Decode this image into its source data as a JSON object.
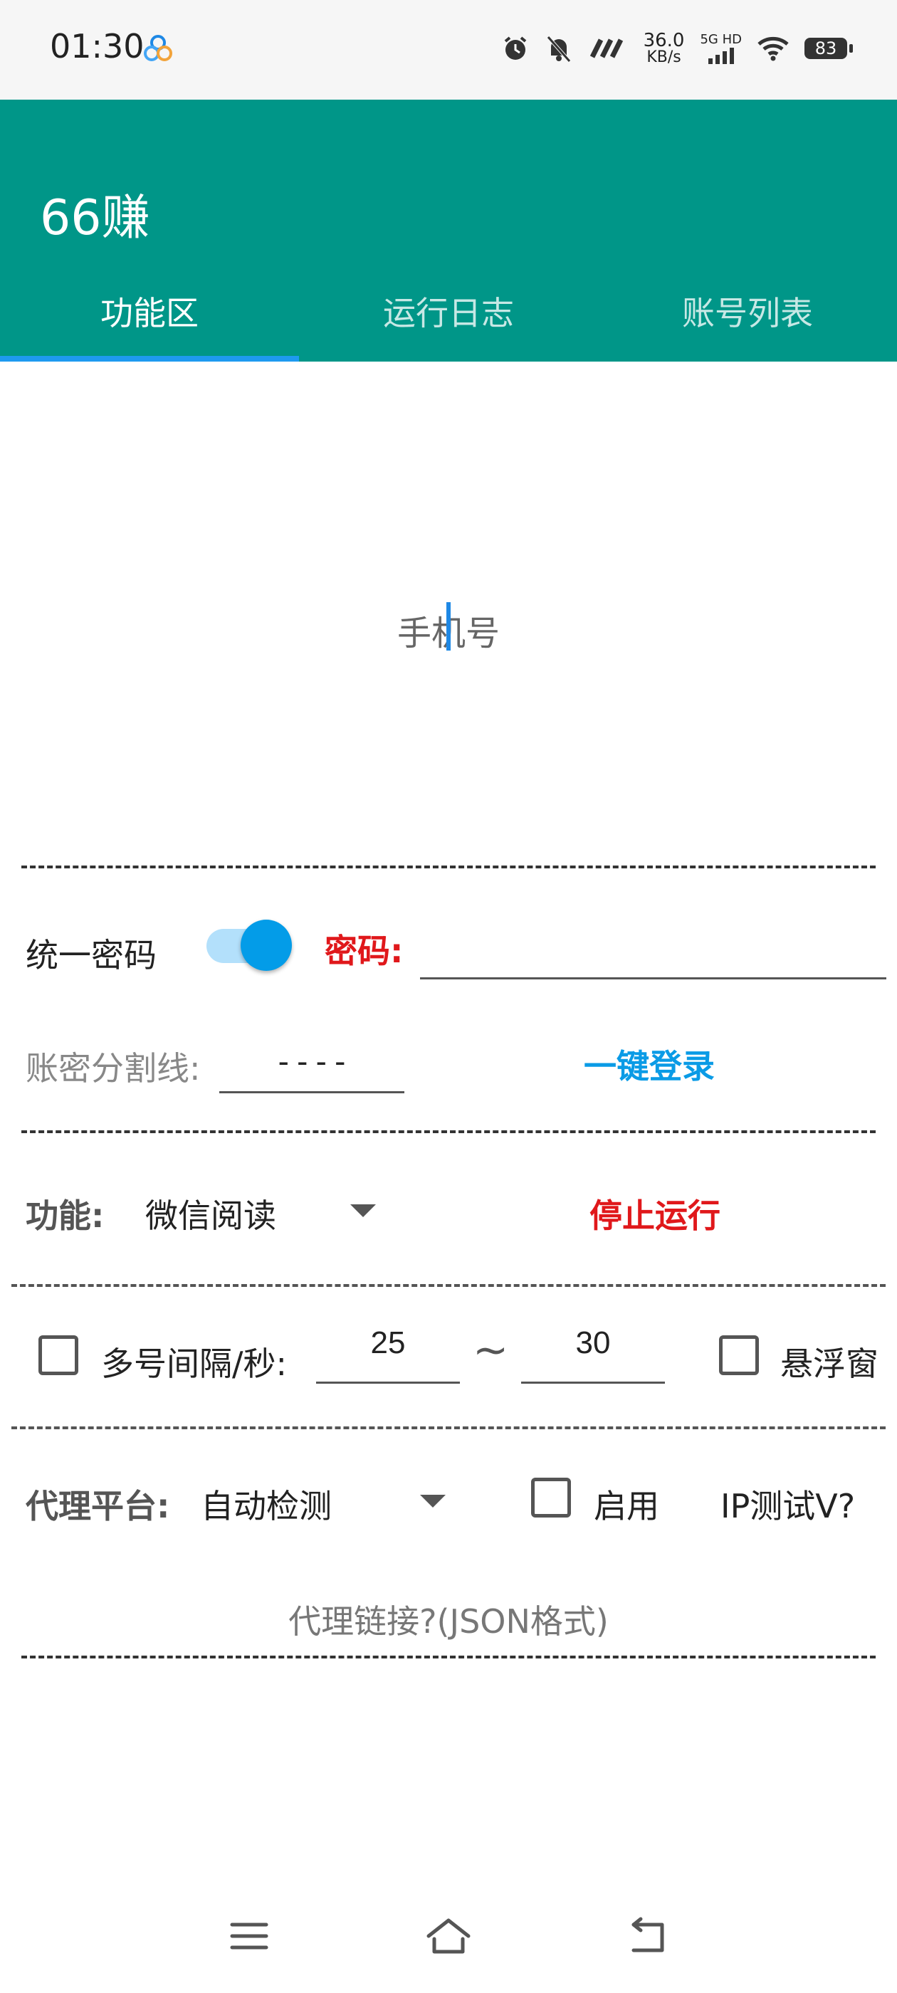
{
  "status_bar": {
    "time": "01:30",
    "net_speed_value": "36.0",
    "net_speed_unit": "KB/s",
    "network_type": "5G HD",
    "battery": "83"
  },
  "app": {
    "title": "66赚",
    "tabs": [
      {
        "label": "功能区",
        "active": true
      },
      {
        "label": "运行日志",
        "active": false
      },
      {
        "label": "账号列表",
        "active": false
      }
    ],
    "accent_color": "#009688",
    "indicator_color": "#1e9af0"
  },
  "phone_input": {
    "placeholder": "手机号"
  },
  "unified_password": {
    "label": "统一密码",
    "enabled": true
  },
  "password": {
    "label": "密码:",
    "value": ""
  },
  "separator": {
    "label": "账密分割线:",
    "value": "----"
  },
  "login_button": {
    "label": "一键登录"
  },
  "function": {
    "label": "功能:",
    "selected": "微信阅读"
  },
  "stop_button": {
    "label": "停止运行"
  },
  "interval": {
    "label": "多号间隔/秒:",
    "min": "25",
    "separator": "~",
    "max": "30",
    "checked": false
  },
  "floating_window": {
    "label": "悬浮窗",
    "checked": false
  },
  "proxy": {
    "label": "代理平台:",
    "selected": "自动检测",
    "enable_label": "启用",
    "enable_checked": false,
    "ip_test_label": "IP测试V?",
    "link_placeholder": "代理链接?(JSON格式)"
  },
  "nav": {
    "icons": [
      "menu-icon",
      "home-icon",
      "back-icon"
    ]
  }
}
